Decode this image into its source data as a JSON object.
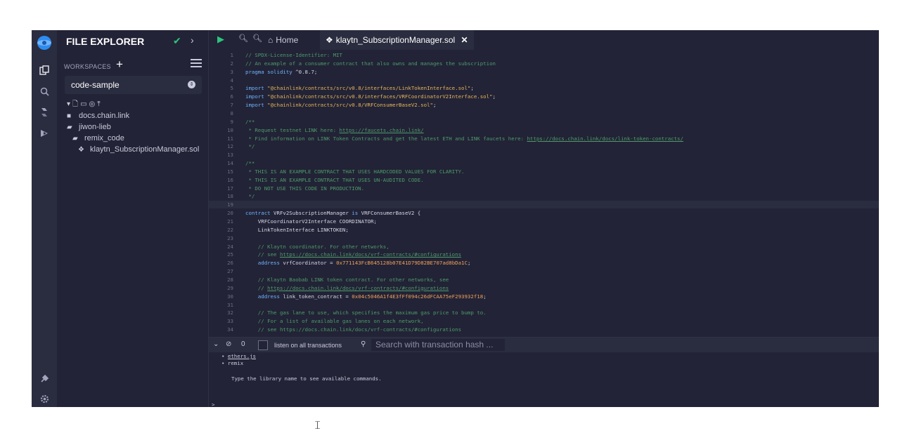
{
  "explorer": {
    "title": "FILE EXPLORER",
    "workspaces_label": "WORKSPACES",
    "workspace_selected": "code-sample",
    "tree": [
      {
        "name": "docs.chain.link",
        "icon": "folder-icon",
        "depth": 0
      },
      {
        "name": "jiwon-lieb",
        "icon": "folder-open-icon",
        "depth": 0
      },
      {
        "name": "remix_code",
        "icon": "folder-open-icon",
        "depth": 1
      },
      {
        "name": "klaytn_SubscriptionManager.sol",
        "icon": "solidity-file-icon",
        "depth": 2
      }
    ]
  },
  "tabs": {
    "home_label": "Home",
    "active_file": "klaytn_SubscriptionManager.sol"
  },
  "code": [
    {
      "n": "1",
      "t": [
        [
          "c",
          "// SPDX-License-Identifier: MIT"
        ]
      ]
    },
    {
      "n": "2",
      "t": [
        [
          "c",
          "// An example of a consumer contract that also owns and manages the subscription"
        ]
      ]
    },
    {
      "n": "3",
      "t": [
        [
          "k",
          "pragma solidity "
        ],
        [
          "p",
          "^0.8.7;"
        ]
      ]
    },
    {
      "n": "4",
      "t": []
    },
    {
      "n": "5",
      "t": [
        [
          "k",
          "import "
        ],
        [
          "s",
          "\"@chainlink/contracts/src/v0.8/interfaces/LinkTokenInterface.sol\""
        ],
        [
          "p",
          ";"
        ]
      ]
    },
    {
      "n": "6",
      "t": [
        [
          "k",
          "import "
        ],
        [
          "s",
          "\"@chainlink/contracts/src/v0.8/interfaces/VRFCoordinatorV2Interface.sol\""
        ],
        [
          "p",
          ";"
        ]
      ]
    },
    {
      "n": "7",
      "t": [
        [
          "k",
          "import "
        ],
        [
          "s",
          "\"@chainlink/contracts/src/v0.8/VRFConsumerBaseV2.sol\""
        ],
        [
          "p",
          ";"
        ]
      ]
    },
    {
      "n": "8",
      "t": []
    },
    {
      "n": "9",
      "t": [
        [
          "c",
          "/**"
        ]
      ]
    },
    {
      "n": "10",
      "t": [
        [
          "c",
          " * Request testnet LINK here: "
        ],
        [
          "l",
          "https://faucets.chain.link/"
        ]
      ]
    },
    {
      "n": "11",
      "t": [
        [
          "c",
          " * Find information on LINK Token Contracts and get the latest ETH and LINK faucets here: "
        ],
        [
          "l",
          "https://docs.chain.link/docs/link-token-contracts/"
        ]
      ]
    },
    {
      "n": "12",
      "t": [
        [
          "c",
          " */"
        ]
      ]
    },
    {
      "n": "13",
      "t": []
    },
    {
      "n": "14",
      "t": [
        [
          "c",
          "/**"
        ]
      ]
    },
    {
      "n": "15",
      "t": [
        [
          "c",
          " * THIS IS AN EXAMPLE CONTRACT THAT USES HARDCODED VALUES FOR CLARITY."
        ]
      ]
    },
    {
      "n": "16",
      "t": [
        [
          "c",
          " * THIS IS AN EXAMPLE CONTRACT THAT USES UN-AUDITED CODE."
        ]
      ]
    },
    {
      "n": "17",
      "t": [
        [
          "c",
          " * DO NOT USE THIS CODE IN PRODUCTION."
        ]
      ]
    },
    {
      "n": "18",
      "t": [
        [
          "c",
          " */"
        ]
      ]
    },
    {
      "n": "19",
      "t": [],
      "highlight": true
    },
    {
      "n": "20",
      "t": [
        [
          "k",
          "contract "
        ],
        [
          "p",
          "VRFv2SubscriptionManager "
        ],
        [
          "k",
          "is "
        ],
        [
          "p",
          "VRFConsumerBaseV2 {"
        ]
      ]
    },
    {
      "n": "21",
      "t": [
        [
          "p",
          "    VRFCoordinatorV2Interface COORDINATOR;"
        ]
      ]
    },
    {
      "n": "22",
      "t": [
        [
          "p",
          "    LinkTokenInterface LINKTOKEN;"
        ]
      ]
    },
    {
      "n": "23",
      "t": []
    },
    {
      "n": "24",
      "t": [
        [
          "c",
          "    // Klaytn coordinator. For other networks,"
        ]
      ]
    },
    {
      "n": "25",
      "t": [
        [
          "c",
          "    // see "
        ],
        [
          "l",
          "https://docs.chain.link/docs/vrf-contracts/#configurations"
        ]
      ]
    },
    {
      "n": "26",
      "t": [
        [
          "k",
          "    address "
        ],
        [
          "p",
          "vrfCoordinator = "
        ],
        [
          "u",
          "0x771143FcB645128b07E41D79D82BE707ad8bDa1C"
        ],
        [
          "p",
          ";"
        ]
      ]
    },
    {
      "n": "27",
      "t": []
    },
    {
      "n": "28",
      "t": [
        [
          "c",
          "    // Klaytn Baobab LINK token contract. For other networks, see"
        ]
      ]
    },
    {
      "n": "29",
      "t": [
        [
          "c",
          "    // "
        ],
        [
          "l",
          "https://docs.chain.link/docs/vrf-contracts/#configurations"
        ]
      ]
    },
    {
      "n": "30",
      "t": [
        [
          "k",
          "    address "
        ],
        [
          "p",
          "link_token_contract = "
        ],
        [
          "u",
          "0x04c5046A1f4E3fFf094c26dFCAA75eF293932f18"
        ],
        [
          "p",
          ";"
        ]
      ]
    },
    {
      "n": "31",
      "t": []
    },
    {
      "n": "32",
      "t": [
        [
          "c",
          "    // The gas lane to use, which specifies the maximum gas price to bump to."
        ]
      ]
    },
    {
      "n": "33",
      "t": [
        [
          "c",
          "    // For a list of available gas lanes on each network,"
        ]
      ]
    },
    {
      "n": "34",
      "t": [
        [
          "c",
          "    // see https://docs.chain.link/docs/vrf-contracts/#configurations"
        ]
      ]
    }
  ],
  "terminal_bar": {
    "count": "0",
    "listen_label": "listen on all transactions",
    "search_placeholder": "Search with transaction hash ..."
  },
  "terminal": {
    "libs": [
      "ethers.js",
      "remix"
    ],
    "hint": "Type the library name to see available commands.",
    "prompt": ">"
  }
}
